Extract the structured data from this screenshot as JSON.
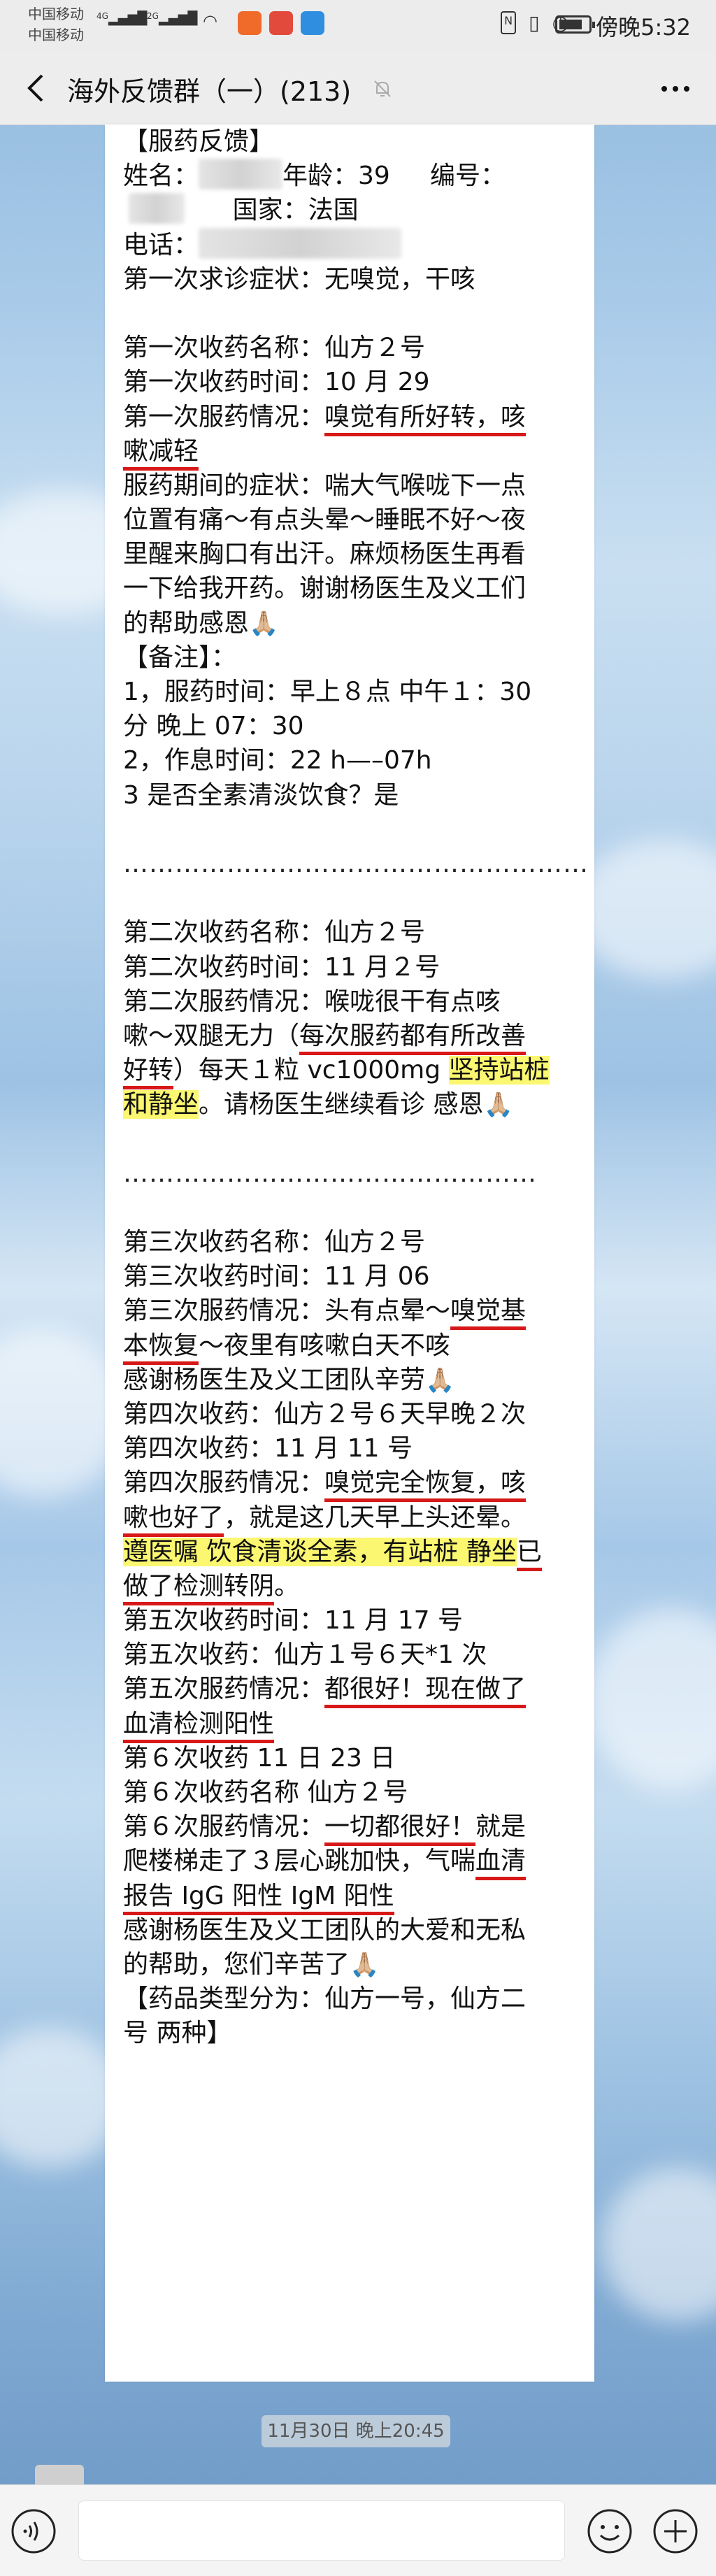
{
  "status_bar": {
    "carrier_1": "中国移动",
    "carrier_2": "中国移动",
    "net_1": "4G",
    "net_2": "2G",
    "time": "傍晚5:32",
    "icons": [
      "signal-icon",
      "wifi-icon",
      "app-notification-icon",
      "nfc-icon",
      "mute-icon",
      "alarm-icon",
      "battery-icon"
    ]
  },
  "nav": {
    "title": "海外反馈群（一）(213)",
    "icons": [
      "back-arrow-icon",
      "bell-off-icon",
      "more-dots-icon"
    ]
  },
  "message": {
    "lines": [
      "【服药反馈】",
      "姓名：",
      "年龄：39",
      "编号：",
      "国家：法国",
      "电话：",
      "第一次求诊症状：无嗅觉，干咳",
      "第一次收药名称：仙方２号",
      "第一次收药时间：10 月 29",
      "第一次服药情况：",
      "嗅觉有所好转，咳",
      "嗽减轻",
      "服药期间的症状：喘大气喉咙下一点",
      "位置有痛～有点头晕～睡眠不好～夜",
      "里醒来胸口有出汗。麻烦杨医生再看",
      "一下给我开药。谢谢杨医生及义工们",
      "的帮助感恩",
      "【备注】：",
      "1，服药时间：早上８点 中午１：30",
      "分 晚上 07：30",
      "2，作息时间：22 h—–07h",
      "3 是否全素清淡饮食？是",
      "………………………………………………",
      "第二次收药名称：仙方２号",
      "第二次收药时间：11 月２号",
      "第二次服药情况：喉咙很干有点咳",
      "嗽～双腿无力（",
      "每次服药都有所改善",
      "好转",
      "）每天１粒 vc1000mg ",
      "坚持站桩",
      "和静坐",
      "。请杨医生继续看诊 感恩",
      "…………………………………………",
      "第三次收药名称：仙方２号",
      "第三次收药时间：11 月 06",
      "第三次服药情况：头有点晕～",
      "嗅觉基",
      "本恢复",
      "～夜里有咳嗽白天不咳",
      "感谢杨医生及义工团队辛劳",
      "第四次收药：仙方２号６天早晚２次",
      "第四次收药：11 月 11 号",
      "第四次服药情况：",
      "嗅觉完全恢复，咳",
      "嗽也好了",
      "，就是这几天早上头还晕。",
      "遵医嘱 饮食清谈全素，有站桩 静坐",
      "已",
      "做了检测转阴",
      "。",
      "第五次收药时间：11 月 17 号",
      "第五次收药：仙方１号６天*1 次",
      "第五次服药情况：",
      "都很好！现在做了",
      "血清检测阳性",
      "第６次收药 11 日 23 日",
      "第６次收药名称 仙方２号",
      "第６次服药情况：",
      "一切都很好！",
      "就是",
      "爬楼梯走了３层心跳加快，气喘",
      "血清",
      "报告 IgG 阳性  IgM 阳性",
      "感谢杨医生及义工团队的大爱和无私",
      "的帮助，您们辛苦了",
      "【药品类型分为：仙方一号，仙方二",
      "号  两种】"
    ],
    "emoji": "🙏🏼"
  },
  "timestamp": "11月30日 晚上20:45",
  "input_bar": {
    "icons": [
      "voice-icon",
      "emoji-icon",
      "plus-icon"
    ]
  },
  "colors": {
    "underline": "#d81818",
    "highlight": "#fbf770",
    "nav_bg": "#ededed"
  }
}
